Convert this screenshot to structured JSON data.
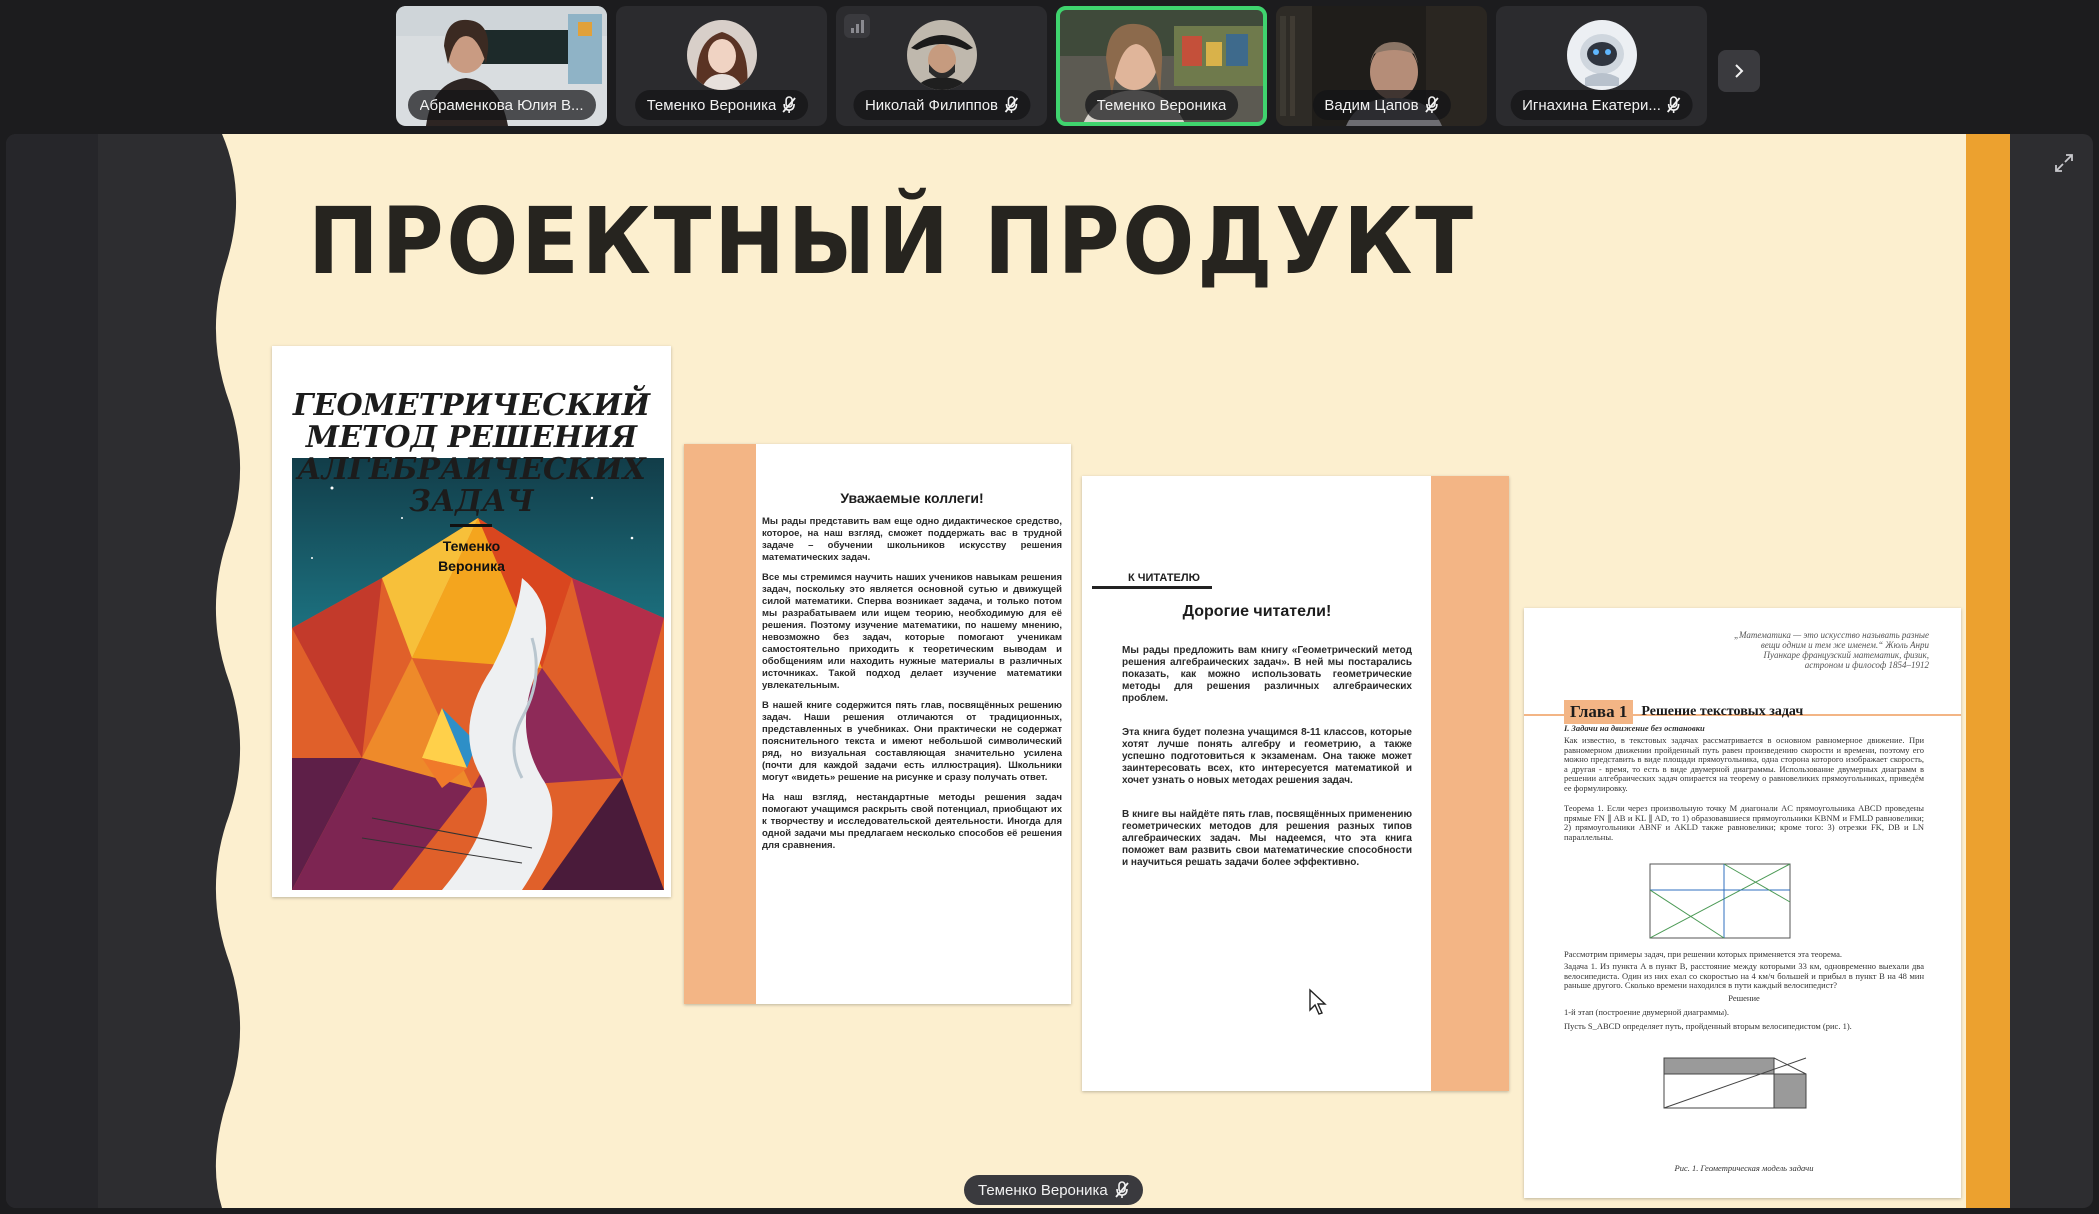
{
  "participants": [
    {
      "name": "Абраменкова Юлия В...",
      "muted": false,
      "video": true,
      "active": false
    },
    {
      "name": "Теменко Вероника",
      "muted": true,
      "video": false,
      "active": false
    },
    {
      "name": "Николай Филиппов",
      "muted": true,
      "video": false,
      "active": false
    },
    {
      "name": "Теменко Вероника",
      "muted": false,
      "video": true,
      "active": true
    },
    {
      "name": "Вадим Цапов",
      "muted": true,
      "video": true,
      "active": false
    },
    {
      "name": "Игнахина Екатери...",
      "muted": true,
      "video": false,
      "active": false
    }
  ],
  "slide": {
    "title": "ПРОЕКТНЫЙ ПРОДУКТ",
    "cover": {
      "title_lines": [
        "ГЕОМЕТРИЧЕСКИЙ",
        "МЕТОД РЕШЕНИЯ",
        "АЛГЕБРАИЧЕСКИХ",
        "ЗАДАЧ"
      ],
      "author_lines": [
        "Теменко",
        "Вероника"
      ]
    },
    "page2": {
      "heading": "Уважаемые коллеги!",
      "paragraphs": [
        "Мы рады представить вам еще одно дидактическое средство, которое, на наш взгляд, сможет поддержать вас в трудной задаче – обучении школьников искусству решения математических задач.",
        "Все мы стремимся научить наших учеников навыкам решения задач, поскольку это является основной сутью и движущей силой математики. Сперва возникает задача, и только потом мы разрабатываем или ищем теорию, необходимую для её решения. Поэтому изучение математики, по нашему мнению, невозможно без задач, которые помогают ученикам самостоятельно приходить к теоретическим выводам и обобщениям или находить нужные материалы в различных источниках. Такой подход делает изучение математики увлекательным.",
        "В нашей книге содержится пять глав, посвящённых решению задач. Наши решения отличаются от традиционных, представленных в учебниках. Они практически не содержат пояснительного текста и имеют небольшой символический ряд, но визуальная составляющая значительно усилена (почти для каждой задачи есть иллюстрация). Школьники могут «видеть» решение на рисунке и сразу получать ответ.",
        "На наш взгляд, нестандартные методы решения задач помогают учащимся раскрыть свой потенциал, приобщают их к творчеству и исследовательской деятельности. Иногда для одной задачи мы предлагаем несколько способов её решения для сравнения."
      ]
    },
    "page3": {
      "label": "К ЧИТАТЕЛЮ",
      "heading": "Дорогие читатели!",
      "paragraphs": [
        "Мы рады предложить вам книгу «Геометрический метод решения алгебраических задач». В ней мы постарались показать, как можно использовать геометрические методы для решения различных алгебраических проблем.",
        "Эта книга будет полезна учащимся 8-11 классов, которые хотят лучше понять алгебру и геометрию, а также успешно подготовиться к экзаменам. Она также может заинтересовать всех, кто интересуется математикой и хочет узнать о новых методах решения задач.",
        "В книге вы найдёте пять глав, посвящённых применению геометрических методов для решения разных типов алгебраических задач. Мы надеемся, что эта книга поможет вам развить свои математические способности и научиться решать задачи более эффективно."
      ]
    },
    "page4": {
      "epigraph": "„Математика — это искусство называть разные вещи одним и тем же именем.“ Жюль Анри Пуанкаре французский математик, физик, астроном и философ 1854–1912",
      "chapter_tag": "Глава 1",
      "chapter_title": "Решение текстовых задач",
      "section": "I. Задачи на движение без остановки",
      "intro": "Как известно, в текстовых задачах рассматривается в основном равномерное движение. При равномерном движении пройденный путь равен произведению скорости и времени, поэтому его можно представить в виде площади прямоугольника, одна сторона которого изображает скорость, а другая - время, то есть в виде двумерной диаграммы. Использование двумерных диаграмм в решении алгебраических задач опирается на теорему о равновеликих прямоугольниках, приведём ее формулировку.",
      "theorem": "Теорема 1. Если через произвольную точку M диагонали AC прямоугольника ABCD проведены прямые FN ∥ AB и KL ∥ AD, то 1) образовавшиеся прямоугольники KBNM и FMLD равновелики; 2) прямоугольники ABNF и AKLD также равновелики; кроме того: 3) отрезки FK, DB и LN параллельны.",
      "examples": "Рассмотрим примеры задач, при решении которых применяется эта теорема.",
      "task": "Задача 1. Из пункта A в пункт B, расстояние между которыми 33 км, одновременно выехали два велосипедиста. Один из них ехал со скоростью на 4 км/ч большей и прибыл в пункт B на 48 мин раньше другого. Сколько времени находился в пути каждый велосипедист?",
      "solution": "Решение",
      "stage": "1-й этап (построение двумерной диаграммы).",
      "let": "Пусть S_ABCD определяет путь, пройденный вторым велосипедистом (рис. 1).",
      "caption": "Рис. 1. Геометрическая модель задачи"
    }
  },
  "speaker": "Теменко Вероника",
  "colors": {
    "active_border": "#3fd46e",
    "slide_bg": "#fcefcf",
    "slide_accent": "#eca12f",
    "page_accent": "#f3b585"
  }
}
